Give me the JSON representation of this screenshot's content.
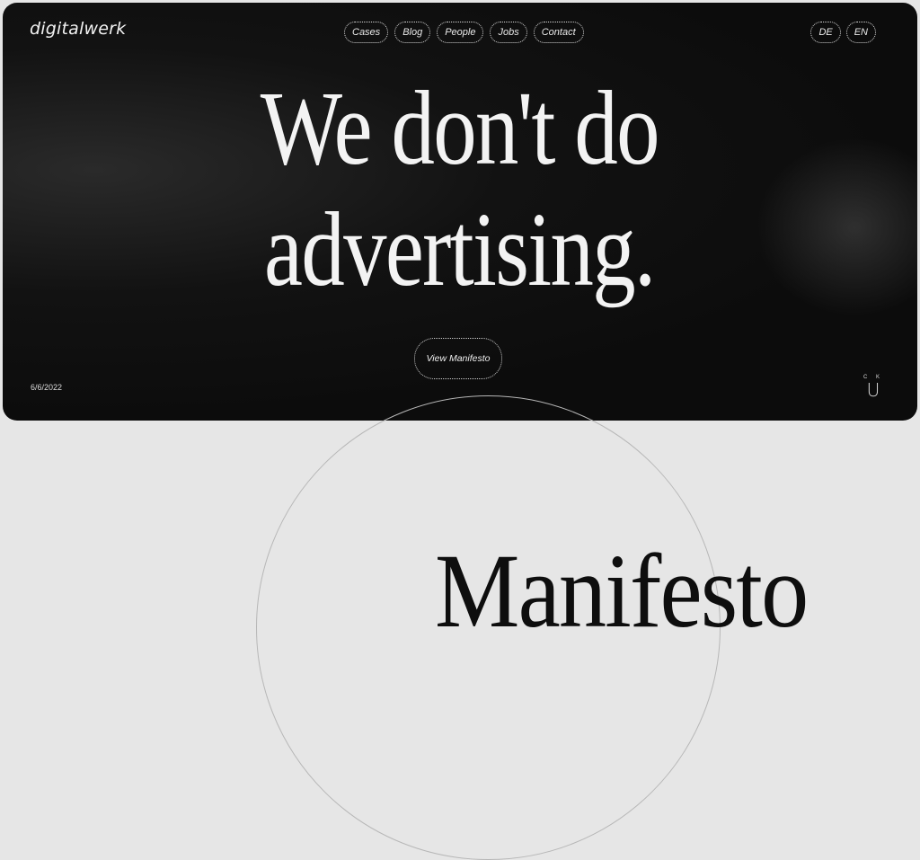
{
  "brand": {
    "logo_text": "digitalwerk"
  },
  "nav": {
    "items": [
      "Cases",
      "Blog",
      "People",
      "Jobs",
      "Contact"
    ]
  },
  "languages": [
    "DE",
    "EN"
  ],
  "hero": {
    "headline_line1": "We don't do",
    "headline_line2": "advertising.",
    "cta_label": "View Manifesto",
    "date": "6/6/2022",
    "badge_top": "C K",
    "badge_letter": "U"
  },
  "section": {
    "title": "Manifesto"
  },
  "colors": {
    "hero_bg": "#0d0d0d",
    "page_bg": "#e6e6e6",
    "text_light": "#f3f3f3",
    "text_dark": "#0e0e0e"
  },
  "icons": {
    "badge": "ck-u-mark"
  }
}
